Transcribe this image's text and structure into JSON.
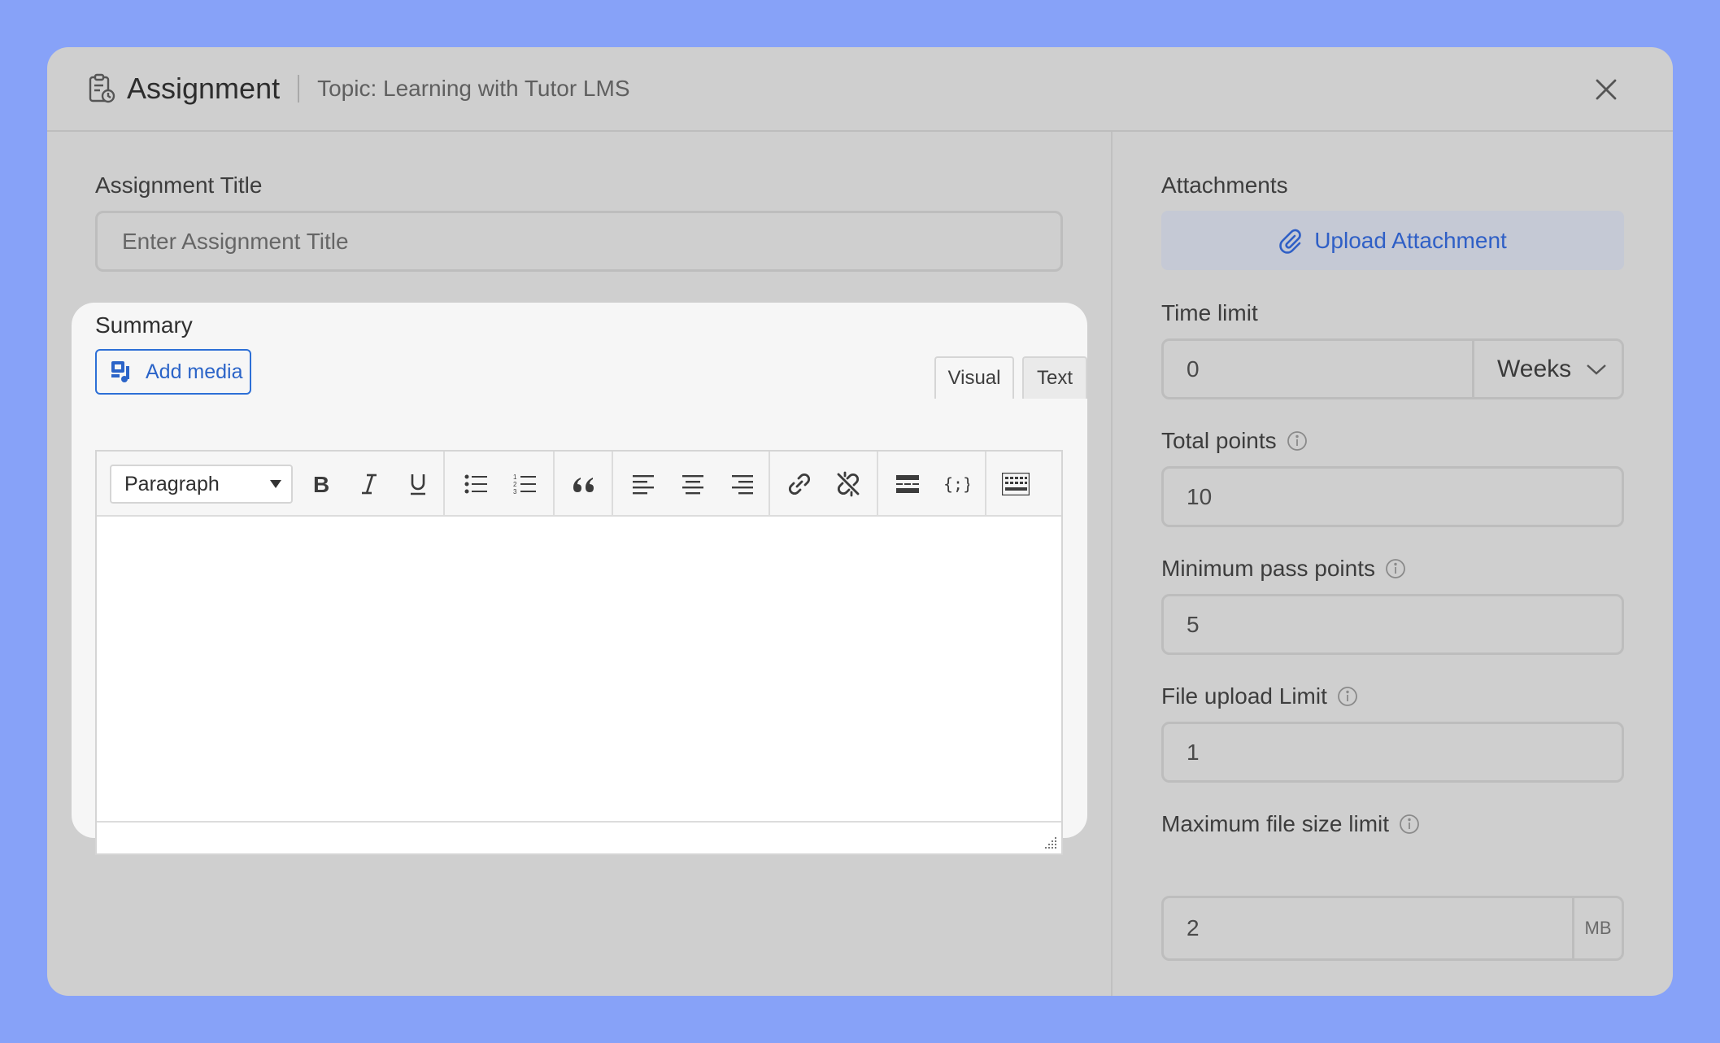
{
  "header": {
    "title": "Assignment",
    "topic": "Topic: Learning with Tutor LMS"
  },
  "form": {
    "title_label": "Assignment Title",
    "title_placeholder": "Enter Assignment Title",
    "summary_label": "Summary",
    "add_media_label": "Add media",
    "tabs": {
      "visual": "Visual",
      "text": "Text"
    },
    "format_select": "Paragraph",
    "editor_content": ""
  },
  "sidebar": {
    "attachments_label": "Attachments",
    "upload_label": "Upload Attachment",
    "time_limit_label": "Time limit",
    "time_limit_value": "0",
    "time_unit": "Weeks",
    "total_points_label": "Total points",
    "total_points_value": "10",
    "min_pass_label": "Minimum pass points",
    "min_pass_value": "5",
    "file_upload_label": "File upload Limit",
    "file_upload_value": "1",
    "max_size_label": "Maximum file size limit",
    "max_size_value": "2",
    "max_size_unit": "MB"
  },
  "colors": {
    "background": "#87a2f8",
    "modal": "#cfcfcf",
    "accent": "#2f5fc6"
  },
  "icons": {
    "header": "assignment-clipboard-icon",
    "close": "close-icon",
    "upload": "paperclip-icon",
    "info": "info-icon",
    "dropdown": "chevron-down-icon"
  }
}
